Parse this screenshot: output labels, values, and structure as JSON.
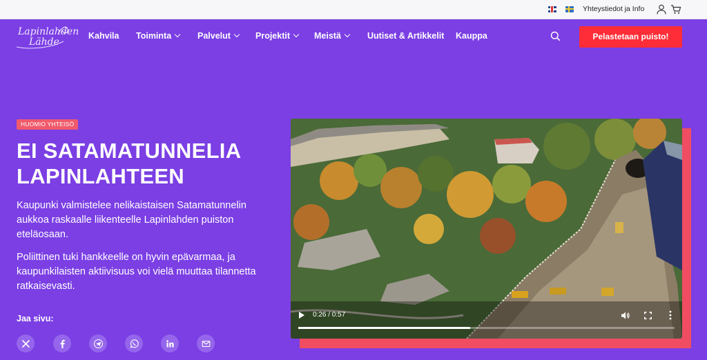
{
  "topbar": {
    "flags": [
      "uk-flag-icon",
      "sweden-flag-icon"
    ],
    "contact_link": "Yhteystiedot ja Info",
    "icons": [
      "user-icon",
      "cart-icon"
    ]
  },
  "logo": {
    "line1": "Lapinlahden",
    "line2": "Lähde"
  },
  "nav": {
    "items": [
      {
        "label": "Kahvila",
        "dropdown": false
      },
      {
        "label": "Toiminta",
        "dropdown": true
      },
      {
        "label": "Palvelut",
        "dropdown": true
      },
      {
        "label": "Projektit",
        "dropdown": true
      },
      {
        "label": "Meistä",
        "dropdown": true
      },
      {
        "label": "Uutiset & Artikkelit",
        "dropdown": false
      },
      {
        "label": "Kauppa",
        "dropdown": false
      }
    ],
    "search_icon": "search-icon",
    "cta_label": "Pelastetaan puisto!"
  },
  "hero": {
    "badge": "HUOMIO YHTEISÖ",
    "title": "EI SATAMATUNNELIA LAPINLAHTEEN",
    "paragraph1": "Kaupunki valmistelee nelikaistaisen Satamatunnelin aukkoa raskaalle liikenteelle Lapinlahden puiston eteläosaan.",
    "paragraph2": "Poliittinen tuki hankkeelle on hyvin epävarmaa, ja kaupunkilaisten aktiivisuus voi vielä muuttaa tilannetta ratkaisevasti.",
    "share_label": "Jaa sivu:",
    "share_icons": [
      "x-icon",
      "facebook-icon",
      "telegram-icon",
      "whatsapp-icon",
      "linkedin-icon",
      "email-icon"
    ]
  },
  "video": {
    "time": "0:26 / 0:57",
    "progress": 0.456,
    "controls": [
      "play-icon",
      "volume-icon",
      "fullscreen-icon",
      "more-icon"
    ]
  },
  "colors": {
    "background": "#7b3fe4",
    "cta": "#ff2d37",
    "badge": "#ef5a6b",
    "video_shadow": "#f04d63"
  }
}
